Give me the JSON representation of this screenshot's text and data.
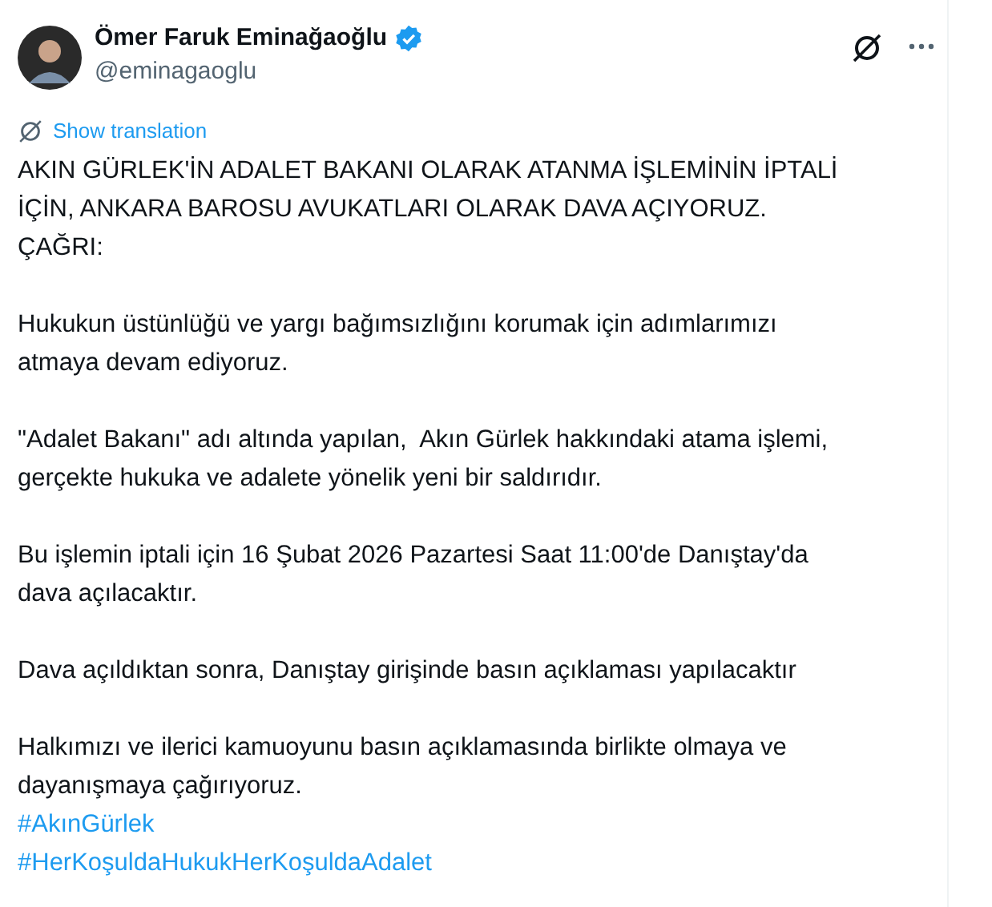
{
  "author": {
    "name": "Ömer Faruk Eminağaoğlu",
    "verified": true,
    "handle": "@eminagaoglu"
  },
  "translate_link": "Show translation",
  "paragraphs": [
    {
      "kind": "text",
      "lines": [
        "AKIN GÜRLEK'İN ADALET BAKANI OLARAK ATANMA İŞLEMİNİN İPTALİ",
        "İÇİN, ANKARA BAROSU AVUKATLARI OLARAK DAVA AÇIYORUZ.",
        "ÇAĞRI:"
      ]
    },
    {
      "kind": "text",
      "lines": [
        "Hukukun üstünlüğü ve yargı bağımsızlığını korumak için adımlarımızı",
        "atmaya devam ediyoruz."
      ]
    },
    {
      "kind": "text",
      "lines": [
        "\"Adalet Bakanı\" adı altında yapılan,  Akın Gürlek hakkındaki atama işlemi,",
        "gerçekte hukuka ve adalete yönelik yeni bir saldırıdır."
      ]
    },
    {
      "kind": "text",
      "lines": [
        "Bu işlemin iptali için 16 Şubat 2026 Pazartesi Saat 11:00'de Danıştay'da",
        "dava açılacaktır."
      ]
    },
    {
      "kind": "text",
      "lines": [
        "Dava açıldıktan sonra, Danıştay girişinde basın açıklaması yapılacaktır"
      ]
    },
    {
      "kind": "text",
      "lines": [
        "Halkımızı ve ilerici kamuoyunu basın açıklamasında birlikte olmaya ve",
        "dayanışmaya çağırıyoruz."
      ]
    },
    {
      "kind": "hashtags",
      "lines": [
        "#AkınGürlek",
        "#HerKoşuldaHukukHerKoşuldaAdalet"
      ]
    }
  ]
}
